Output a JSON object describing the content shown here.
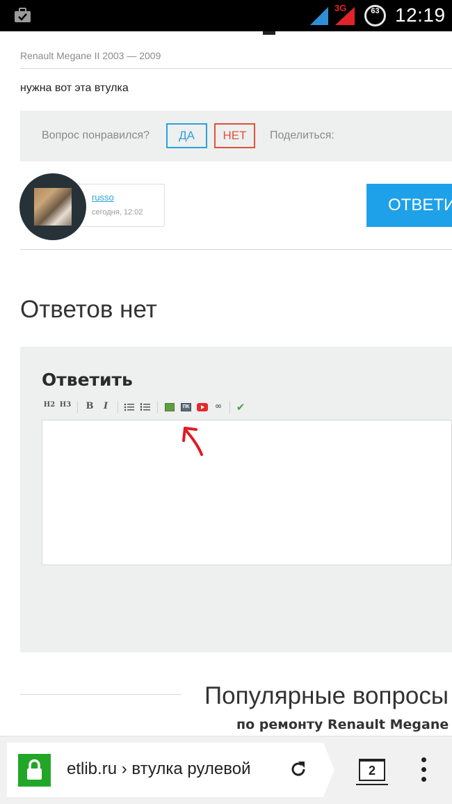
{
  "status_bar": {
    "network_type": "3G",
    "battery_level": "63",
    "time": "12:19"
  },
  "question": {
    "car_model": "Renault Megane II 2003 — 2009",
    "text": "нужна вот эта втулка"
  },
  "vote": {
    "label": "Вопрос понравился?",
    "yes_label": "ДА",
    "no_label": "НЕТ",
    "share_label": "Поделиться:"
  },
  "author": {
    "name": "russo",
    "time": "сегодня, 12:02"
  },
  "reply_button_label": "ОТВЕТИТЬ",
  "answers_heading": "Ответов нет",
  "reply_form": {
    "title": "Ответить",
    "toolbar": {
      "h2": "H2",
      "h3": "H3",
      "bold": "B",
      "italic": "I",
      "pk": "ПК"
    }
  },
  "popular": {
    "title": "Популярные вопросы",
    "subtitle": "по ремонту Renault Megane"
  },
  "browser": {
    "url": "etlib.ru › втулка рулевой",
    "tab_count": "2"
  },
  "colors": {
    "accent_blue": "#1ea1e8",
    "no_red": "#e0523a",
    "secure_green": "#22a628",
    "annotation_red": "#e01b24"
  }
}
